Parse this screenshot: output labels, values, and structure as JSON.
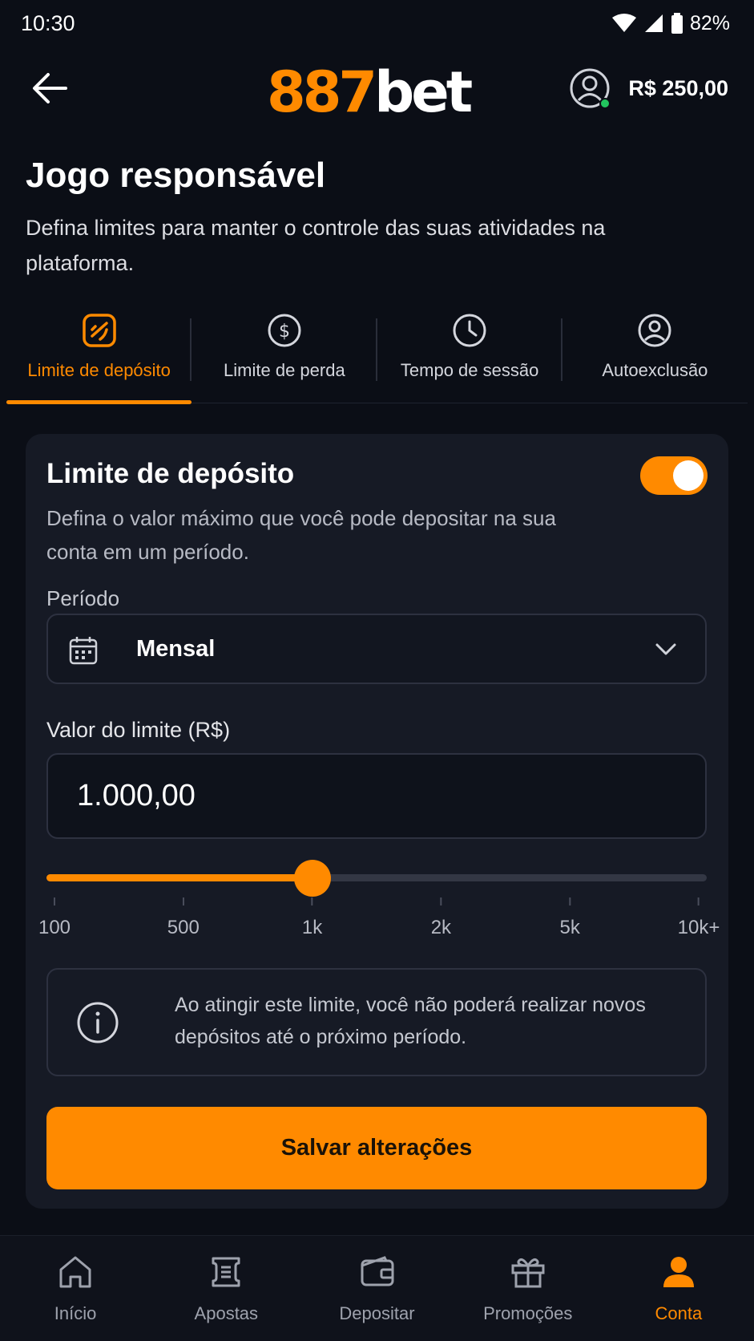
{
  "status_bar": {
    "time": "10:30",
    "battery": "82%"
  },
  "header": {
    "logo_number": "887",
    "logo_word": "bet",
    "balance": "R$ 250,00"
  },
  "page": {
    "title": "Jogo responsável",
    "subtitle": "Defina limites para manter o controle das suas atividades na plataforma."
  },
  "tabs": [
    {
      "label": "Limite de depósito",
      "icon": "deposit-limit-icon",
      "active": true
    },
    {
      "label": "Limite de perda",
      "icon": "dollar-circle-icon",
      "active": false
    },
    {
      "label": "Tempo de sessão",
      "icon": "clock-icon",
      "active": false
    },
    {
      "label": "Autoexclusão",
      "icon": "user-circle-icon",
      "active": false
    }
  ],
  "card": {
    "title": "Limite de depósito",
    "toggle_on": true,
    "description": "Defina o valor máximo que você pode depositar na sua conta em um período.",
    "period_label": "Período",
    "period_value": "Mensal",
    "limit_label": "Valor do limite (R$)",
    "limit_value": "1.000,00",
    "slider": {
      "ticks": [
        "100",
        "500",
        "1k",
        "2k",
        "5k",
        "10k+"
      ],
      "selected_index": 2
    },
    "info_text": "Ao atingir este limite, você não poderá realizar novos depósitos até o próximo período.",
    "save_label": "Salvar alterações"
  },
  "bottom_nav": [
    {
      "label": "Início",
      "icon": "home-icon",
      "active": false
    },
    {
      "label": "Apostas",
      "icon": "bet-slip-icon",
      "active": false
    },
    {
      "label": "Depositar",
      "icon": "wallet-icon",
      "active": false
    },
    {
      "label": "Promoções",
      "icon": "gift-icon",
      "active": false
    },
    {
      "label": "Conta",
      "icon": "account-icon",
      "active": true
    }
  ],
  "colors": {
    "accent": "#ff8a00",
    "background": "#0b0e16",
    "card": "#161a25",
    "online": "#22c55e"
  }
}
